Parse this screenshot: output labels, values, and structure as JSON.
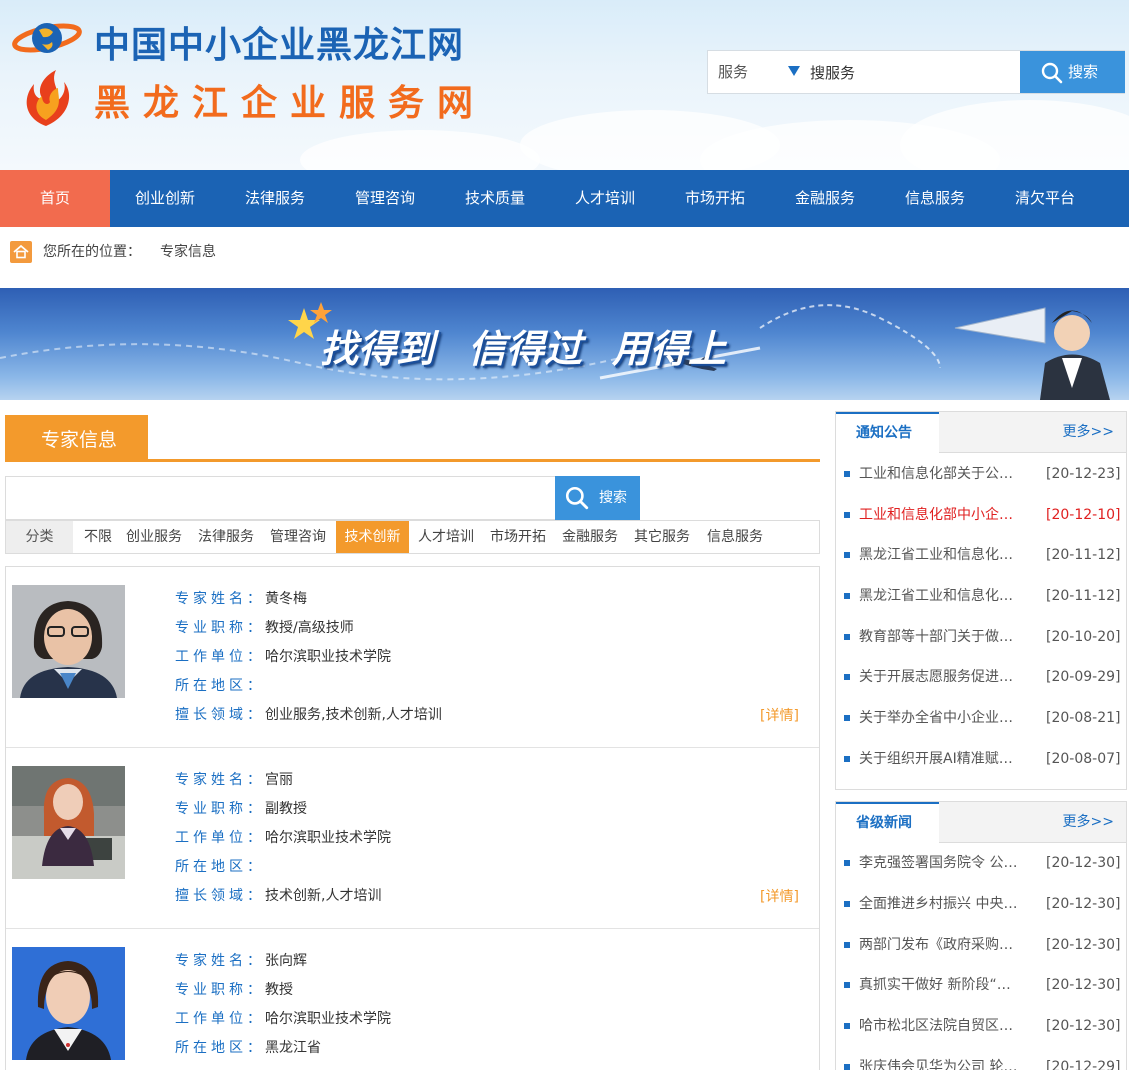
{
  "header": {
    "title_line1": "中国中小企业黑龙江网",
    "title_line2": "黑龙江企业服务网",
    "search": {
      "category": "服务",
      "query": "搜服务",
      "button": "搜索"
    }
  },
  "nav": [
    "首页",
    "创业创新",
    "法律服务",
    "管理咨询",
    "技术质量",
    "人才培训",
    "市场开拓",
    "金融服务",
    "信息服务",
    "清欠平台"
  ],
  "breadcrumb": {
    "label": "您所在的位置：",
    "current": "专家信息"
  },
  "banner": {
    "slogan": [
      "找得到",
      "信得过",
      "用得上"
    ]
  },
  "section_title": "专家信息",
  "expert_search": {
    "value": "",
    "button": "搜索"
  },
  "categories": {
    "label": "分类",
    "items": [
      "不限",
      "创业服务",
      "法律服务",
      "管理咨询",
      "技术创新",
      "人才培训",
      "市场开拓",
      "金融服务",
      "其它服务",
      "信息服务"
    ],
    "active": "技术创新"
  },
  "field_labels": {
    "name": "专家姓名：",
    "title": "专业职称：",
    "unit": "工作单位：",
    "region": "所在地区：",
    "field": "擅长领域："
  },
  "detail_label": "[详情]",
  "experts": [
    {
      "name": "黄冬梅",
      "title": "教授/高级技师",
      "unit": "哈尔滨职业技术学院",
      "region": "",
      "field": "创业服务,技术创新,人才培训"
    },
    {
      "name": "宫丽",
      "title": "副教授",
      "unit": "哈尔滨职业技术学院",
      "region": "",
      "field": "技术创新,人才培训"
    },
    {
      "name": "张向辉",
      "title": "教授",
      "unit": "哈尔滨职业技术学院",
      "region": "黑龙江省",
      "field": ""
    }
  ],
  "notice_box": {
    "tab": "通知公告",
    "more": "更多>>",
    "items": [
      {
        "title": "工业和信息化部关于公…",
        "date": "[20-12-23]"
      },
      {
        "title": "工业和信息化部中小企…",
        "date": "[20-12-10]",
        "highlight": true
      },
      {
        "title": "黑龙江省工业和信息化…",
        "date": "[20-11-12]"
      },
      {
        "title": "黑龙江省工业和信息化…",
        "date": "[20-11-12]"
      },
      {
        "title": "教育部等十部门关于做…",
        "date": "[20-10-20]"
      },
      {
        "title": "关于开展志愿服务促进…",
        "date": "[20-09-29]"
      },
      {
        "title": "关于举办全省中小企业…",
        "date": "[20-08-21]"
      },
      {
        "title": "关于组织开展AI精准赋…",
        "date": "[20-08-07]"
      }
    ]
  },
  "news_box": {
    "tab": "省级新闻",
    "more": "更多>>",
    "items": [
      {
        "title": "李克强签署国务院令 公…",
        "date": "[20-12-30]"
      },
      {
        "title": "全面推进乡村振兴 中央…",
        "date": "[20-12-30]"
      },
      {
        "title": "两部门发布《政府采购…",
        "date": "[20-12-30]"
      },
      {
        "title": "真抓实干做好 新阶段“…",
        "date": "[20-12-30]"
      },
      {
        "title": "哈市松北区法院自贸区…",
        "date": "[20-12-30]"
      },
      {
        "title": "张庆伟会见华为公司 轮…",
        "date": "[20-12-29]"
      }
    ]
  },
  "colors": {
    "nav_bg": "#1b63b4",
    "nav_active": "#f26b4e",
    "accent_orange": "#f39a2c",
    "link_blue": "#1b6fc3",
    "search_button": "#3a93dc"
  }
}
